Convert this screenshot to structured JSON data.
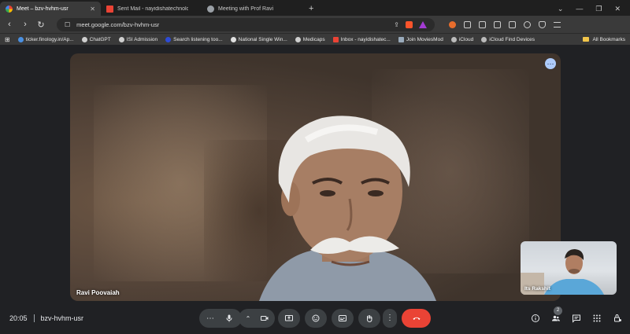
{
  "browser": {
    "tabs": [
      {
        "label": "Meet – bzv-hvhm-usr",
        "active": true,
        "icon": "meet-icon"
      },
      {
        "label": "Sent Mail - nayidishatechnologies@",
        "active": false,
        "icon": "gmail-icon"
      },
      {
        "label": "Meeting with Prof Ravi",
        "active": false,
        "icon": "globe-icon"
      }
    ],
    "new_tab": "+",
    "window_controls": [
      "⌄",
      "—",
      "❐",
      "✕"
    ],
    "url": "meet.google.com/bzv-hvhm-usr"
  },
  "bookmarks": [
    {
      "label": "ticker.finology.in/Ap...",
      "color": "#4a90e2"
    },
    {
      "label": "ChatGPT",
      "color": "#cfcfcf"
    },
    {
      "label": "ISI Admission",
      "color": "#cfcfcf"
    },
    {
      "label": "Search listening too...",
      "color": "#2d4bd6"
    },
    {
      "label": "National Single Win...",
      "color": "#e0e0e0"
    },
    {
      "label": "Medicaps",
      "color": "#cfcfcf"
    },
    {
      "label": "Inbox - nayidishatec...",
      "color": "#ea4335"
    },
    {
      "label": "Join MoviesMod",
      "color": "#9ab"
    },
    {
      "label": "iCloud",
      "color": "#bbb"
    },
    {
      "label": "iCloud Find Devices",
      "color": "#bbb"
    }
  ],
  "all_bookmarks": "All Bookmarks",
  "meeting": {
    "main_participant": "Ravi Poovaiah",
    "self_participant": "Its Rakshit",
    "time": "20:05",
    "code": "bzv-hvhm-usr",
    "participant_count": "2"
  },
  "colors": {
    "end_call": "#ea4335",
    "control_bg": "#3c4043",
    "stage_bg": "#202124"
  }
}
